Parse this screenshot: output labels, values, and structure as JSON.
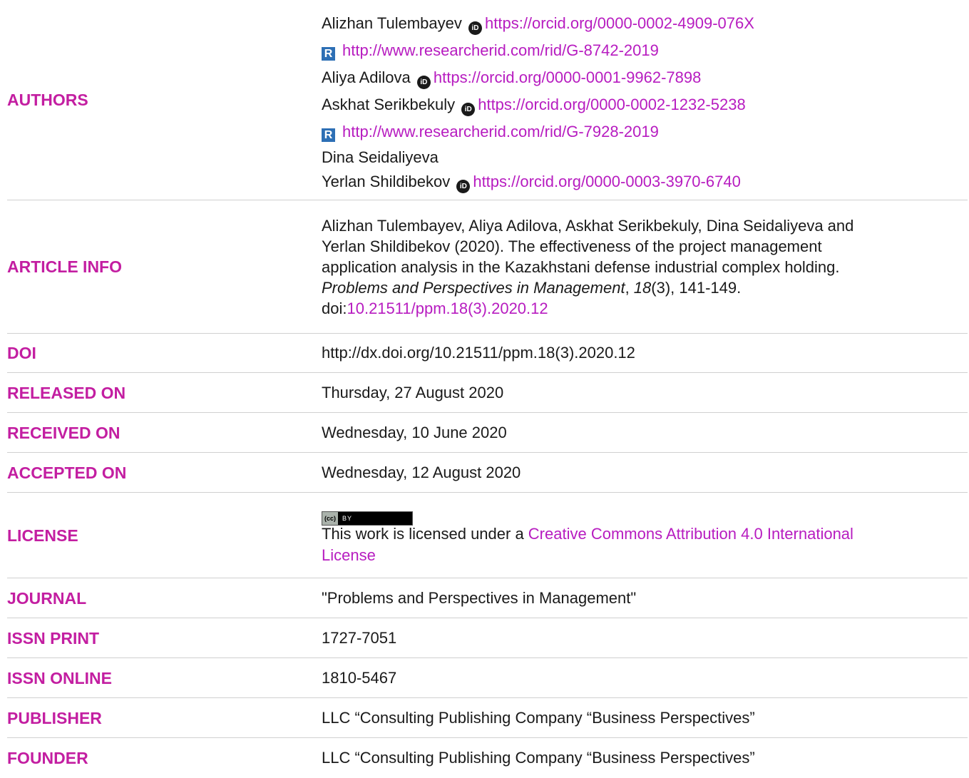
{
  "labels": {
    "authors": "AUTHORS",
    "article_info": "ARTICLE INFO",
    "doi": "DOI",
    "released_on": "RELEASED ON",
    "received_on": "RECEIVED ON",
    "accepted_on": "ACCEPTED ON",
    "license": "LICENSE",
    "journal": "JOURNAL",
    "issn_print": "ISSN PRINT",
    "issn_online": "ISSN ONLINE",
    "publisher": "PUBLISHER",
    "founder": "FOUNDER"
  },
  "authors": [
    {
      "name": "Alizhan Tulembayev",
      "orcid": "https://orcid.org/0000-0002-4909-076X",
      "researcherid": "http://www.researcherid.com/rid/G-8742-2019"
    },
    {
      "name": "Aliya Adilova",
      "orcid": "https://orcid.org/0000-0001-9962-7898"
    },
    {
      "name": "Askhat Serikbekuly",
      "orcid": "https://orcid.org/0000-0002-1232-5238",
      "researcherid": "http://www.researcherid.com/rid/G-7928-2019"
    },
    {
      "name": "Dina Seidaliyeva"
    },
    {
      "name": "Yerlan Shildibekov",
      "orcid": "https://orcid.org/0000-0003-3970-6740"
    }
  ],
  "icons": {
    "orcid_glyph": "iD",
    "researcherid_glyph": "R",
    "cc_left": "(cc)",
    "cc_right": "BY"
  },
  "article_info": {
    "line1": "Alizhan Tulembayev, Aliya Adilova, Askhat Serikbekuly, Dina Seidaliyeva and",
    "line2": "Yerlan Shildibekov (2020). The effectiveness of the project management",
    "line3": "application analysis in the Kazakhstani defense industrial complex holding.",
    "journal_italic": "Problems and Perspectives in Management",
    "sep1": ", ",
    "volume_italic": "18",
    "issue_pages": "(3), 141-149.",
    "doi_prefix": "doi:",
    "doi_link": "10.21511/ppm.18(3).2020.12"
  },
  "doi": "http://dx.doi.org/10.21511/ppm.18(3).2020.12",
  "released_on": "Thursday, 27 August 2020",
  "received_on": "Wednesday, 10 June 2020",
  "accepted_on": "Wednesday, 12 August 2020",
  "license": {
    "text": "This work is licensed under a ",
    "link_line1": "Creative Commons Attribution 4.0 International",
    "link_line2": "License"
  },
  "journal": "\"Problems and Perspectives in Management\"",
  "issn_print": "1727-7051",
  "issn_online": "1810-5467",
  "publisher": "LLC “Consulting Publishing Company “Business Perspectives”",
  "founder": "LLC “Consulting Publishing Company “Business Perspectives”",
  "colors": {
    "label": "#c31ea1",
    "link": "#b71cc0",
    "text": "#1a1a1a",
    "divider": "#d0d0d0"
  }
}
